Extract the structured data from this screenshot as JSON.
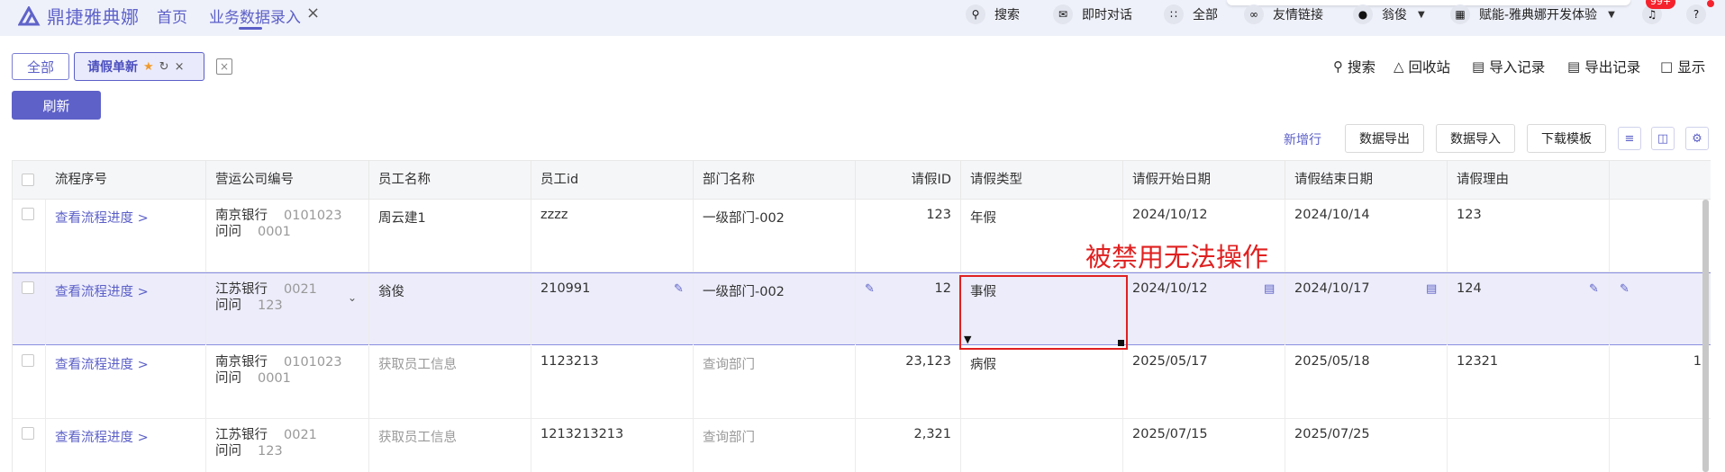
{
  "app": {
    "logo_text": "鼎捷雅典娜"
  },
  "nav": {
    "home": "首页",
    "active_tab": "业务数据录入"
  },
  "topbar": {
    "search": "搜索",
    "chat": "即时对话",
    "all": "全部",
    "links": "友情链接",
    "user": "翁俊",
    "tenant": "赋能-雅典娜开发体验",
    "bell_badge": "99+"
  },
  "views": {
    "all": "全部",
    "current": "请假单新"
  },
  "actions": {
    "refresh": "刷新"
  },
  "right_tools": {
    "search": "搜索",
    "recycle": "回收站",
    "import_records": "导入记录",
    "export_records": "导出记录",
    "display": "显示"
  },
  "table_toolbar": {
    "add_row": "新增行",
    "export": "数据导出",
    "import": "数据导入",
    "download_template": "下载模板"
  },
  "columns": [
    "流程序号",
    "营运公司编号",
    "员工名称",
    "员工id",
    "部门名称",
    "请假ID",
    "请假类型",
    "请假开始日期",
    "请假结束日期",
    "请假理由"
  ],
  "rows": [
    {
      "flow": "查看流程进度 >",
      "bank": "南京银行",
      "bank_code": "0101023",
      "sub": "问问",
      "sub_code": "0001",
      "emp_name": "周云建1",
      "emp_id": "zzzz",
      "dept": "一级部门-002",
      "leave_id": "123",
      "leave_type": "年假",
      "start": "2024/10/12",
      "end": "2024/10/14",
      "reason": "123",
      "extra": ""
    },
    {
      "flow": "查看流程进度 >",
      "bank": "江苏银行",
      "bank_code": "0021",
      "sub": "问问",
      "sub_code": "123",
      "emp_name": "翁俊",
      "emp_id": "210991",
      "dept": "一级部门-002",
      "leave_id": "12",
      "leave_type": "事假",
      "start": "2024/10/12",
      "end": "2024/10/17",
      "reason": "124",
      "extra": ""
    },
    {
      "flow": "查看流程进度 >",
      "bank": "南京银行",
      "bank_code": "0101023",
      "sub": "问问",
      "sub_code": "0001",
      "emp_name": "获取员工信息",
      "emp_id": "1123213",
      "dept": "查询部门",
      "leave_id": "23,123",
      "leave_type": "病假",
      "start": "2025/05/17",
      "end": "2025/05/18",
      "reason": "12321",
      "extra": "1"
    },
    {
      "flow": "查看流程进度 >",
      "bank": "江苏银行",
      "bank_code": "0021",
      "sub": "问问",
      "sub_code": "123",
      "emp_name": "获取员工信息",
      "emp_id": "1213213213",
      "dept": "查询部门",
      "leave_id": "2,321",
      "leave_type": "",
      "start": "2025/07/15",
      "end": "2025/07/25",
      "reason": "",
      "extra": ""
    }
  ],
  "annotation": {
    "disabled_label": "被禁用无法操作"
  },
  "colors": {
    "accent": "#5e61c8",
    "annotation": "#e02020",
    "selected_row": "#ececfa"
  }
}
